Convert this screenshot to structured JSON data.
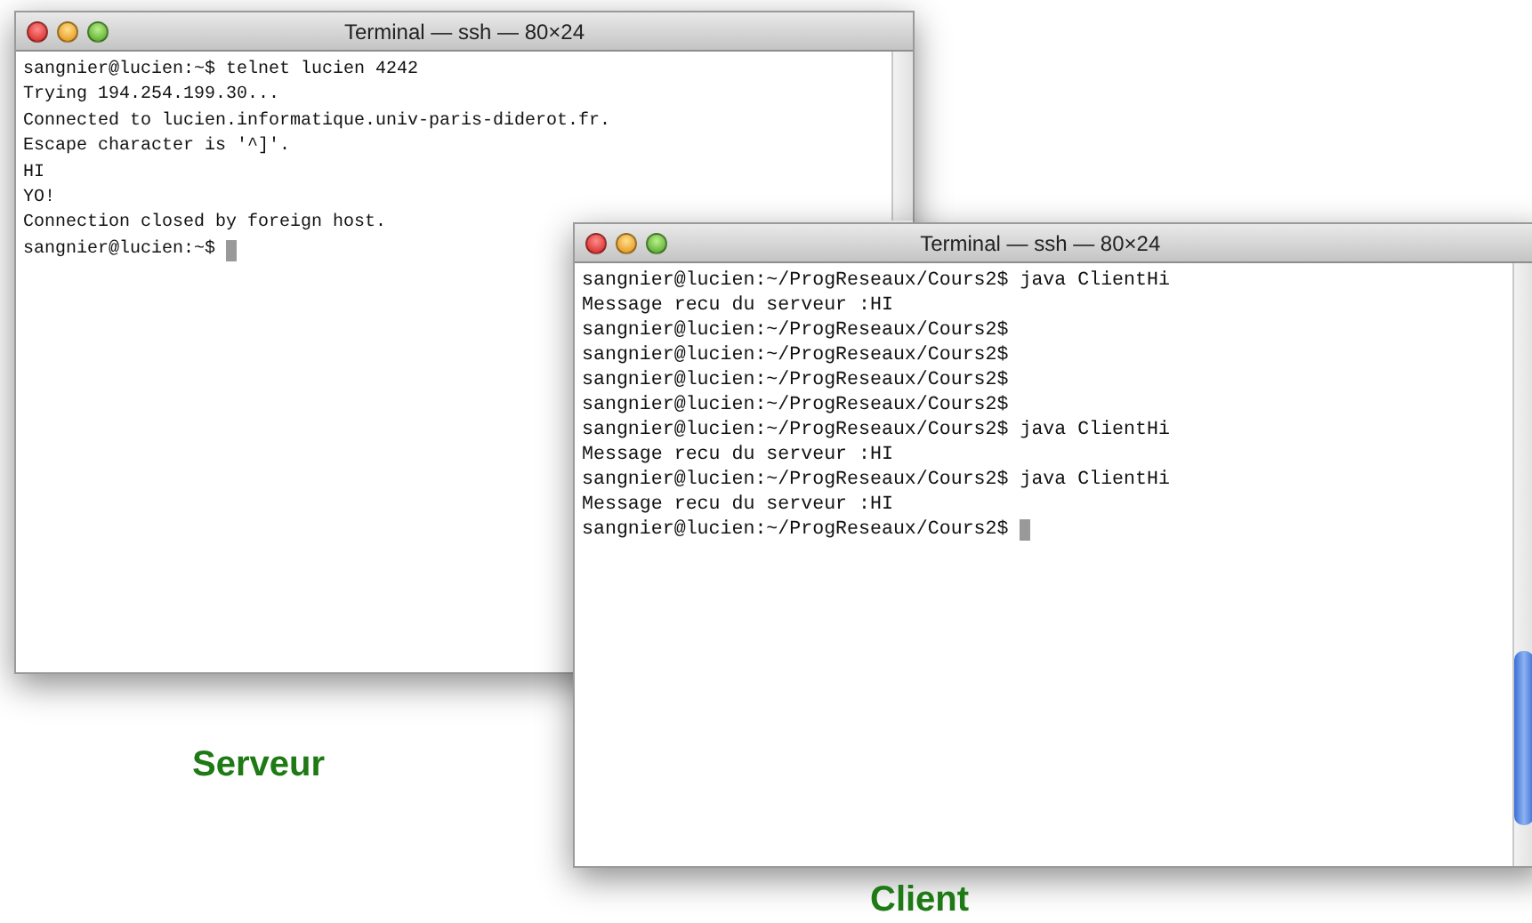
{
  "windows": [
    {
      "title": "Terminal — ssh — 80×24",
      "lines": [
        "sangnier@lucien:~$ telnet lucien 4242",
        "Trying 194.254.199.30...",
        "Connected to lucien.informatique.univ-paris-diderot.fr.",
        "Escape character is '^]'.",
        "HI",
        "YO!",
        "Connection closed by foreign host.",
        "sangnier@lucien:~$"
      ]
    },
    {
      "title": "Terminal — ssh — 80×24",
      "lines": [
        "sangnier@lucien:~/ProgReseaux/Cours2$ java ClientHi",
        "Message recu du serveur :HI",
        "sangnier@lucien:~/ProgReseaux/Cours2$",
        "sangnier@lucien:~/ProgReseaux/Cours2$",
        "sangnier@lucien:~/ProgReseaux/Cours2$",
        "sangnier@lucien:~/ProgReseaux/Cours2$",
        "sangnier@lucien:~/ProgReseaux/Cours2$ java ClientHi",
        "Message recu du serveur :HI",
        "sangnier@lucien:~/ProgReseaux/Cours2$ java ClientHi",
        "Message recu du serveur :HI",
        "sangnier@lucien:~/ProgReseaux/Cours2$"
      ]
    }
  ],
  "captions": [
    "Serveur",
    "Client"
  ]
}
